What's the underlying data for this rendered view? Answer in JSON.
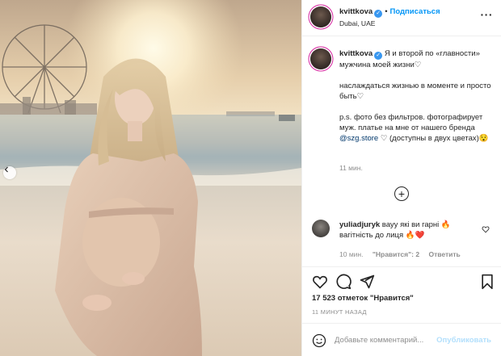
{
  "header": {
    "username": "kvittkova",
    "follow_label": "Подписаться",
    "location": "Dubai, UAE",
    "more": "···"
  },
  "caption": {
    "username": "kvittkova",
    "line1": "Я и второй по «главности» мужчина моей жизни",
    "line2": "наслаждаться жизнью в моменте и просто быть",
    "line3a": "p.s. фото без фильтров. фотографирует муж. платье на мне от нашего бренда ",
    "mention": "@szg.store",
    "line3b": " (доступны в двух цветах)",
    "time": "11 мин."
  },
  "comment": {
    "username": "yuliadjuryk",
    "text": " вауу які ви гарні 🔥 вагітність до лиця 🔥❤️",
    "time": "10 мин.",
    "likes": "\"Нравится\": 2",
    "reply": "Ответить"
  },
  "likes_text": "17 523 отметок \"Нравится\"",
  "posted_ago": "11 МИНУТ НАЗАД",
  "add_comment": {
    "placeholder": "Добавьте комментарий...",
    "post_label": "Опубликовать"
  },
  "icons": {
    "verified": "verified-badge-icon",
    "heart": "heart-icon",
    "comment": "comment-icon",
    "share": "share-icon",
    "save": "bookmark-icon",
    "emoji": "smile-icon",
    "load_more": "plus-circle-icon",
    "prev": "chevron-left-icon"
  },
  "colors": {
    "link": "#0095f6",
    "verified": "#3897f0",
    "avatar_ring": "#d6249f",
    "muted": "#8e8e8e"
  }
}
